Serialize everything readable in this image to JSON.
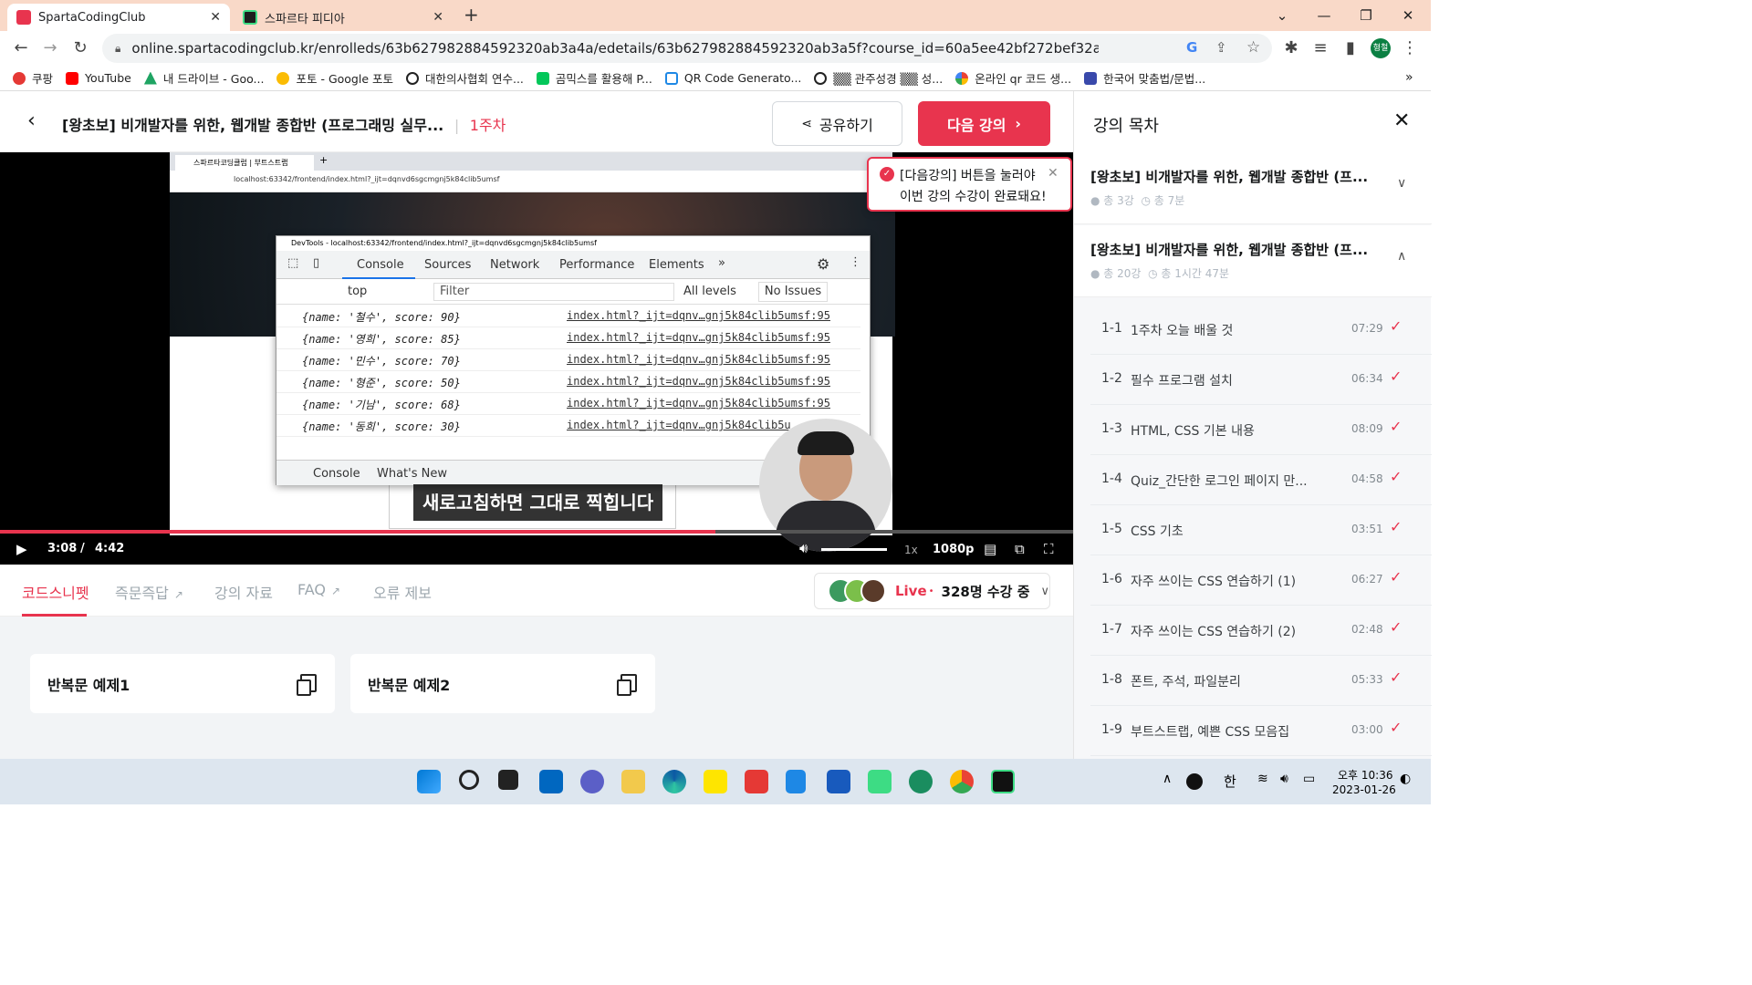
{
  "browser": {
    "tabs": [
      {
        "title": "SpartaCodingClub",
        "active": true
      },
      {
        "title": "스파르타 피디아",
        "active": false
      }
    ],
    "url": "online.spartacodingclub.kr/enrolleds/63b627982884592320ab3a4a/edetails/63b627982884592320ab3a5f?course_id=60a5ee42bf272bef32a58fb9",
    "profile_label": "형철",
    "bookmarks": [
      {
        "label": "쿠팡",
        "color": "#e53935"
      },
      {
        "label": "YouTube",
        "color": "#ff0000"
      },
      {
        "label": "내 드라이브 - Goo...",
        "color": "#1fa463"
      },
      {
        "label": "포토 - Google 포토",
        "color": "#fbbc04"
      },
      {
        "label": "대한의사협회 연수...",
        "color": "#222222"
      },
      {
        "label": "곰믹스를 활용해 P...",
        "color": "#03c75a"
      },
      {
        "label": "QR Code Generato...",
        "color": "#1e88e5"
      },
      {
        "label": "▒▒ 관주성경 ▒▒ 성...",
        "color": "#222222"
      },
      {
        "label": "온라인 qr 코드 생...",
        "color": "#ea4335"
      },
      {
        "label": "한국어 맞춤법/문법...",
        "color": "#3949ab"
      }
    ]
  },
  "header": {
    "course_title": "[왕초보] 비개발자를 위한, 웹개발 종합반 (프로그래밍 실무...",
    "week": "1주차",
    "share_label": "공유하기",
    "next_label": "다음 강의"
  },
  "tooltip": {
    "line1_bold": "[다음강의]",
    "line1_rest": " 버튼을 눌러야",
    "line2": "이번 강의 수강이 완료돼요!"
  },
  "video": {
    "inner_tab_title": "스파르타코딩클럽 | 부트스트랩",
    "inner_url": "localhost:63342/frontend/index.html?_ijt=dqnvd6sgcmgnj5k84clib5umsf",
    "devtools_title": "DevTools - localhost:63342/frontend/index.html?_ijt=dqnvd6sgcmgnj5k84clib5umsf",
    "devtools_tabs": [
      "Console",
      "Sources",
      "Network",
      "Performance",
      "Elements"
    ],
    "context": "top",
    "filter_placeholder": "Filter",
    "levels": "All levels",
    "issues": "No Issues",
    "console_rows": [
      {
        "obj": "{name: '철수', score: 90}",
        "src": "index.html?_ijt=dqnv…gnj5k84clib5umsf:95"
      },
      {
        "obj": "{name: '영희', score: 85}",
        "src": "index.html?_ijt=dqnv…gnj5k84clib5umsf:95"
      },
      {
        "obj": "{name: '민수', score: 70}",
        "src": "index.html?_ijt=dqnv…gnj5k84clib5umsf:95"
      },
      {
        "obj": "{name: '형준', score: 50}",
        "src": "index.html?_ijt=dqnv…gnj5k84clib5umsf:95"
      },
      {
        "obj": "{name: '기남', score: 68}",
        "src": "index.html?_ijt=dqnv…gnj5k84clib5umsf:95"
      },
      {
        "obj": "{name: '동희', score: 30}",
        "src": "index.html?_ijt=dqnv…gnj5k84clib5u"
      }
    ],
    "drawer_tabs": [
      "Console",
      "What's New"
    ],
    "subtitle": "새로고침하면 그대로 찍힙니다",
    "current_time": "3:08",
    "duration": "4:42",
    "progress_fraction": 0.667,
    "speed": "1x",
    "quality": "1080p"
  },
  "subtabs": [
    {
      "label": "코드스니펫",
      "active": true
    },
    {
      "label": "즉문즉답",
      "active": false
    },
    {
      "label": "강의 자료",
      "active": false
    },
    {
      "label": "FAQ",
      "active": false
    },
    {
      "label": "오류 제보",
      "active": false
    }
  ],
  "live": {
    "badge": "Live",
    "count_text": "328명 수강 중"
  },
  "snippets": [
    {
      "label": "반복문 예제1"
    },
    {
      "label": "반복문 예제2"
    }
  ],
  "sidebar": {
    "title": "강의 목차",
    "chapters": [
      {
        "title": "[왕초보] 비개발자를 위한, 웹개발 종합반 (프...",
        "lessons": "총 3강",
        "time": "총 7분"
      },
      {
        "title": "[왕초보] 비개발자를 위한, 웹개발 종합반 (프...",
        "lessons": "총 20강",
        "time": "총 1시간 47분"
      }
    ],
    "lessons": [
      {
        "num": "1-1",
        "name": "1주차 오늘 배울 것",
        "dur": "07:29"
      },
      {
        "num": "1-2",
        "name": "필수 프로그램 설치",
        "dur": "06:34"
      },
      {
        "num": "1-3",
        "name": "HTML, CSS 기본 내용",
        "dur": "08:09"
      },
      {
        "num": "1-4",
        "name": "Quiz_간단한 로그인 페이지 만...",
        "dur": "04:58"
      },
      {
        "num": "1-5",
        "name": "CSS 기초",
        "dur": "03:51"
      },
      {
        "num": "1-6",
        "name": "자주 쓰이는 CSS 연습하기 (1)",
        "dur": "06:27"
      },
      {
        "num": "1-7",
        "name": "자주 쓰이는 CSS 연습하기 (2)",
        "dur": "02:48"
      },
      {
        "num": "1-8",
        "name": "폰트, 주석, 파일분리",
        "dur": "05:33"
      },
      {
        "num": "1-9",
        "name": "부트스트랩, 예쁜 CSS 모음집",
        "dur": "03:00"
      }
    ]
  },
  "taskbar": {
    "ime": "한",
    "time": "오후 10:36",
    "date": "2023-01-26"
  }
}
